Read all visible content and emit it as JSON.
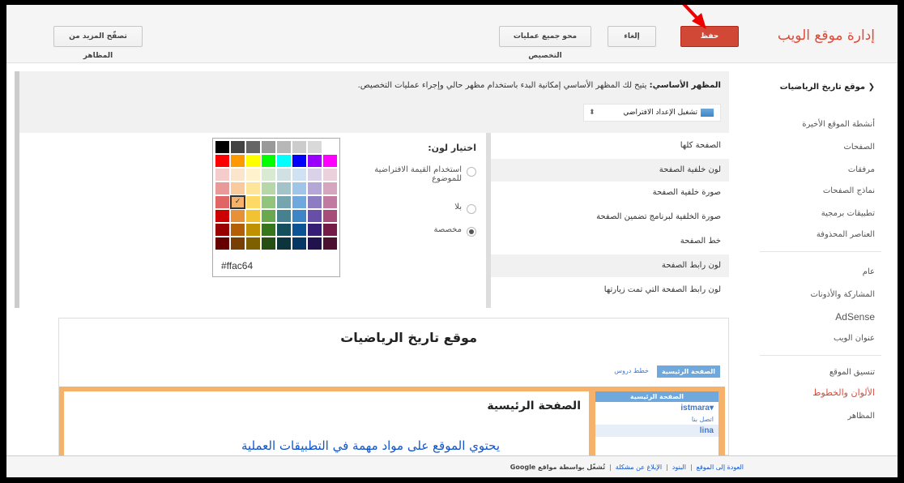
{
  "app": {
    "title": "إدارة موقع الويب"
  },
  "toolbar": {
    "save_label": "حفظ",
    "cancel_label": "إلغاء",
    "reset_label": "محو جميع عمليات التخصيص",
    "browse_label": "تصفّح المزيد من المظاهر"
  },
  "sidebar": {
    "site_name": "موقع تاريخ الرياضيات",
    "group1": [
      "أنشطة الموقع الأخيرة",
      "الصفحات",
      "مرفقات",
      "نماذج الصفحات",
      "تطبيقات برمجية",
      "العناصر المحذوفة"
    ],
    "group2": [
      "عام",
      "المشاركة والأذونات",
      "AdSense",
      "عنوان الويب"
    ],
    "group3": [
      "تنسيق الموقع",
      "الألوان والخطوط",
      "المظاهر"
    ]
  },
  "basic": {
    "label": "المظهر الأساسي:",
    "description": "يتيح لك المظهر الأساسي إمكانية البدء باستخدام مظهر حالي وإجراء عمليات التخصيص.",
    "select_value": "تشغيل الإعداد الافتراضي"
  },
  "custom_items": [
    "الصفحة كلها",
    "لون خلفية الصفحة",
    "صورة خلفية الصفحة",
    "صورة الخلفية لبرنامج تضمين الصفحة",
    "خط الصفحة",
    "لون رابط الصفحة",
    "لون رابط الصفحة التي تمت زيارتها"
  ],
  "color_picker": {
    "label": "اختيار لون:",
    "options": [
      "استخدام القيمة الافتراضية للموضوع",
      "بلا",
      "مخصصة"
    ],
    "selected_index": 2,
    "hex_value": "#ffac64",
    "rows": [
      [
        "#000000",
        "#434343",
        "#666666",
        "#999999",
        "#b7b7b7",
        "#cccccc",
        "#d9d9d9",
        "#ffffff"
      ],
      [
        "#ff0000",
        "#ff9900",
        "#ffff00",
        "#00ff00",
        "#00ffff",
        "#0000ff",
        "#9900ff",
        "#ff00ff"
      ],
      [
        "#f4cccc",
        "#fce5cd",
        "#fff2cc",
        "#d9ead3",
        "#d0e0e3",
        "#cfe2f3",
        "#d9d2e9",
        "#ead1dc"
      ],
      [
        "#ea9999",
        "#f9cb9c",
        "#ffe599",
        "#b6d7a8",
        "#a2c4c9",
        "#9fc5e8",
        "#b4a7d6",
        "#d5a6bd"
      ],
      [
        "#e06666",
        "#f6b26b",
        "#ffd966",
        "#93c47d",
        "#76a5af",
        "#6fa8dc",
        "#8e7cc3",
        "#c27ba0"
      ],
      [
        "#cc0000",
        "#e69138",
        "#f1c232",
        "#6aa84f",
        "#45818e",
        "#3d85c6",
        "#674ea7",
        "#a64d79"
      ],
      [
        "#990000",
        "#b45f06",
        "#bf9000",
        "#38761d",
        "#134f5c",
        "#0b5394",
        "#351c75",
        "#741b47"
      ],
      [
        "#660000",
        "#783f04",
        "#7f6000",
        "#274e13",
        "#0c343d",
        "#073763",
        "#20124d",
        "#4c1130"
      ]
    ]
  },
  "preview": {
    "site_title": "موقع تاريخ الرياضيات",
    "tabs": [
      "الصفحة الرئيسية",
      "خطط دروس"
    ],
    "heading": "الصفحة الرئيسية",
    "body": "يحتوي الموقع على مواد مهمة في التطبيقات العملية",
    "sidebar_head": "الصفحة الرئيسية",
    "sidebar_rows": [
      "istmara",
      "اتصل بنا",
      "lina"
    ]
  },
  "footer": {
    "links": [
      "العودة إلى الموقع",
      "البنود",
      "الإبلاغ عن مشكلة"
    ],
    "powered": "تُشغّل بواسطة مواقع Google"
  }
}
